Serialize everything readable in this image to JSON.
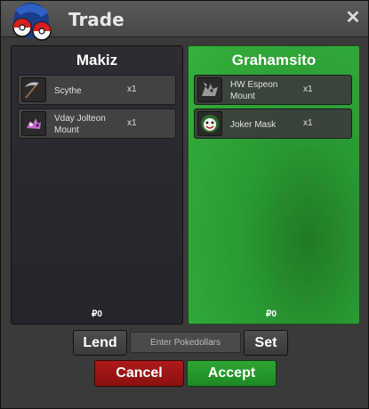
{
  "window": {
    "title": "Trade",
    "close_glyph": "✕"
  },
  "currency_symbol": "₽",
  "left_panel": {
    "name": "Makiz",
    "items": [
      {
        "name": "Scythe",
        "qty": "x1",
        "icon": "scythe-icon"
      },
      {
        "name": "Vday Jolteon Mount",
        "qty": "x1",
        "icon": "jolteon-mount-icon"
      }
    ],
    "money": "0"
  },
  "right_panel": {
    "name": "Grahamsito",
    "items": [
      {
        "name": "HW Espeon Mount",
        "qty": "x1",
        "icon": "espeon-mount-icon"
      },
      {
        "name": "Joker Mask",
        "qty": "x1",
        "icon": "joker-mask-icon"
      }
    ],
    "money": "0"
  },
  "controls": {
    "lend_label": "Lend",
    "money_placeholder": "Enter Pokedollars",
    "set_label": "Set",
    "cancel_label": "Cancel",
    "accept_label": "Accept"
  },
  "colors": {
    "accept_panel": "#2a9a33",
    "cancel_button": "#b01a1a",
    "accept_button": "#2ea534"
  }
}
